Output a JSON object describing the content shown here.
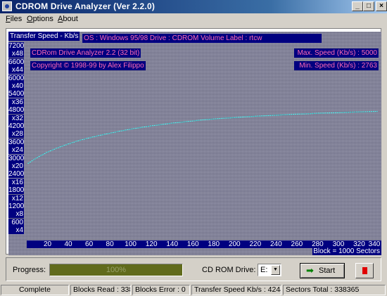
{
  "window": {
    "title": "CDROM Drive Analyzer (Ver 2.2.0)",
    "minimize_glyph": "_",
    "maximize_glyph": "□",
    "close_glyph": "×"
  },
  "menu": [
    {
      "first": "F",
      "rest": "iles"
    },
    {
      "first": "O",
      "rest": "ptions"
    },
    {
      "first": "A",
      "rest": "bout"
    }
  ],
  "graph": {
    "speed_label": "Transfer Speed - Kb/s",
    "info_line": "OS : Windows 95/98    Drive : CDROM    Volume Label : rtcw",
    "app_line": "CDRom Drive Analyzer 2.2 (32 bit)",
    "copyright": "Copyright © 1998-99 by Alex Filippo",
    "max_speed": "Max. Speed (Kb/s) : 5000",
    "min_speed": "Min. Speed (Kb/s) : 2763",
    "block_label": "Block = 1000 Sectors",
    "trace_color": "#40e0e0"
  },
  "chart_data": {
    "type": "line",
    "xlabel": "",
    "ylabel": "Transfer Speed - Kb/s",
    "xlim": [
      0,
      340
    ],
    "ylim": [
      0,
      7200
    ],
    "x_ticks": [
      "20",
      "40",
      "60",
      "80",
      "100",
      "120",
      "140",
      "160",
      "180",
      "200",
      "220",
      "240",
      "260",
      "280",
      "300",
      "320",
      "340"
    ],
    "y_ticks": [
      "7200",
      "x48",
      "6600",
      "x44",
      "6000",
      "x40",
      "5400",
      "x36",
      "4800",
      "x32",
      "4200",
      "x28",
      "3600",
      "x24",
      "3000",
      "x20",
      "2400",
      "x16",
      "1800",
      "x12",
      "1200",
      "x8",
      "600",
      "x4"
    ],
    "series": [
      {
        "x": [
          1,
          10,
          20,
          30,
          40,
          50,
          60,
          70,
          80,
          90,
          100,
          110,
          120,
          130,
          140,
          150,
          160,
          170,
          180,
          190,
          200,
          210,
          220,
          230,
          240,
          250,
          260,
          270,
          280,
          290,
          300,
          310,
          320,
          330,
          338
        ],
        "values": [
          2763,
          2980,
          3180,
          3340,
          3480,
          3600,
          3700,
          3790,
          3870,
          3950,
          4020,
          4080,
          4140,
          4190,
          4240,
          4280,
          4320,
          4360,
          4390,
          4420,
          4440,
          4470,
          4490,
          4510,
          4530,
          4550,
          4570,
          4580,
          4600,
          4610,
          4620,
          4640,
          4650,
          4660,
          4670
        ]
      }
    ]
  },
  "controls": {
    "progress_label": "Progress:",
    "progress_value": 1.0,
    "progress_text": "100%",
    "drive_label": "CD ROM Drive:",
    "drive_value": "E:",
    "drive_arrow": "▼",
    "start_icon": "➡",
    "start_label": "Start"
  },
  "status": {
    "state": "Complete",
    "blocks_read": "Blocks Read : 338",
    "blocks_error": "Blocks Error : 0",
    "transfer_speed": "Transfer Speed Kb/s : 4244",
    "sectors_total": "Sectors Total : 338365"
  }
}
